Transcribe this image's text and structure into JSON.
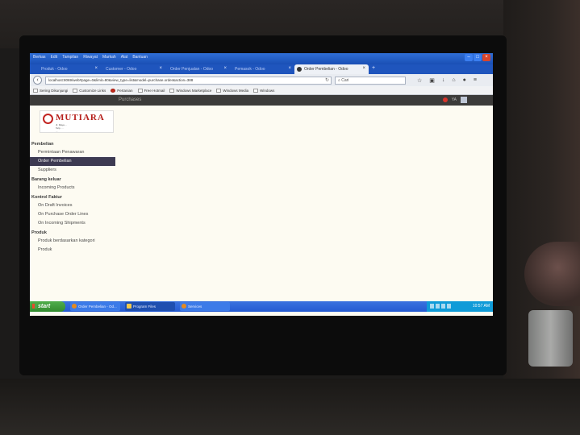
{
  "browser": {
    "menu": [
      "Berkas",
      "Edit",
      "Tampilan",
      "Riwayat",
      "Markah",
      "Alat",
      "Bantuan"
    ],
    "tabs": [
      {
        "label": "Produk - Odoo",
        "active": false
      },
      {
        "label": "Customer - Odoo",
        "active": false
      },
      {
        "label": "Order Penjualan - Odoo",
        "active": false
      },
      {
        "label": "Pemasok - Odoo",
        "active": false
      },
      {
        "label": "Order Pembelian - Odoo",
        "active": true
      }
    ],
    "url": "localhost:8069/web#page=0&limit=80&view_type=list&model=purchase.order&action=388",
    "search_placeholder": "Cari",
    "bookmarks": [
      "Sering Dikunjungi",
      "Customize Links",
      "Pertanian",
      "Free Hotmail",
      "Windows Marketplace",
      "Windows Media",
      "Windows"
    ]
  },
  "odoo": {
    "top_menu": "Purchases",
    "user_short": "YA",
    "logo": {
      "brand": "MUTIARA",
      "line1": "Jl. Raya ...",
      "line2": "Telp. ...",
      "line3": "..."
    },
    "sidebar": [
      {
        "type": "section",
        "label": "Pembelian"
      },
      {
        "type": "item",
        "label": "Permintaan Penawaran",
        "active": false
      },
      {
        "type": "item",
        "label": "Order Pembelian",
        "active": true
      },
      {
        "type": "item",
        "label": "Suppliers",
        "active": false
      },
      {
        "type": "section",
        "label": "Barang keluar"
      },
      {
        "type": "item",
        "label": "Incoming Products",
        "active": false
      },
      {
        "type": "section",
        "label": "Kontrol Faktur"
      },
      {
        "type": "item",
        "label": "On Draft Invoices",
        "active": false
      },
      {
        "type": "item",
        "label": "On Purchase Order Lines",
        "active": false
      },
      {
        "type": "item",
        "label": "On Incoming Shipments",
        "active": false
      },
      {
        "type": "section",
        "label": "Produk"
      },
      {
        "type": "item",
        "label": "Produk berdasarkan kategori",
        "active": false
      },
      {
        "type": "item",
        "label": "Produk",
        "active": false
      }
    ]
  },
  "taskbar": {
    "start_label": "start",
    "buttons": [
      {
        "label": "Order Pembelian - Od...",
        "kind": "firefox",
        "active": false
      },
      {
        "label": "Program Files",
        "kind": "folder",
        "active": true
      },
      {
        "label": "Services",
        "kind": "app",
        "active": false
      }
    ],
    "clock": "10:57 AM"
  }
}
